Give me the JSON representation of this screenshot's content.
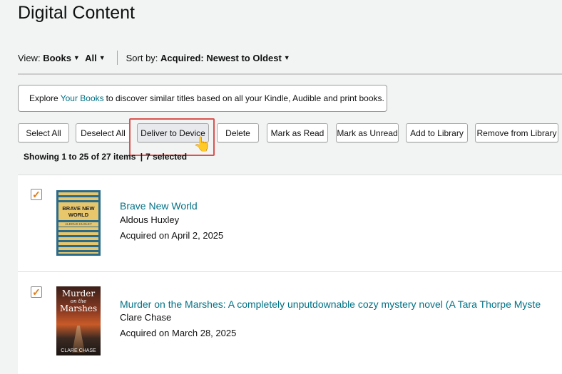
{
  "page_title": "Digital Content",
  "view_bar": {
    "view_label": "View:",
    "view_value": "Books",
    "filter_value": "All",
    "sort_label": "Sort by:",
    "sort_value": "Acquired: Newest to Oldest"
  },
  "explore": {
    "prefix": "Explore",
    "link": "Your Books",
    "suffix": "to discover similar titles based on all your Kindle, Audible and print books."
  },
  "actions": {
    "select_all": "Select All",
    "deselect_all": "Deselect All",
    "deliver": "Deliver to Device",
    "delete": "Delete",
    "mark_read": "Mark as Read",
    "mark_unread": "Mark as Unread",
    "add_library": "Add to Library",
    "remove_library": "Remove from Library"
  },
  "status": {
    "showing": "Showing 1 to 25 of 27 items",
    "separator": "|",
    "selected": "7 selected"
  },
  "books": [
    {
      "title": "Brave New World",
      "author": "Aldous Huxley",
      "acquired": "Acquired on April 2, 2025",
      "checked": true,
      "cover": {
        "title": "BRAVE NEW WORLD",
        "author": "ALDOUS HUXLEY"
      }
    },
    {
      "title": "Murder on the Marshes: A completely unputdownable cozy mystery novel (A Tara Thorpe Myste",
      "author": "Clare Chase",
      "acquired": "Acquired on March 28, 2025",
      "checked": true,
      "cover": {
        "line1": "Murder",
        "line2": "on the",
        "line3": "Marshes",
        "author": "CLARE CHASE"
      }
    }
  ],
  "colors": {
    "link": "#007185",
    "checkmark": "#e47911",
    "highlight": "#d9534f",
    "background": "#f2f4f4"
  },
  "icons": {
    "checkbox": "checkmark-icon",
    "dropdown": "caret-down-icon",
    "cursor": "hand-pointer-icon"
  }
}
